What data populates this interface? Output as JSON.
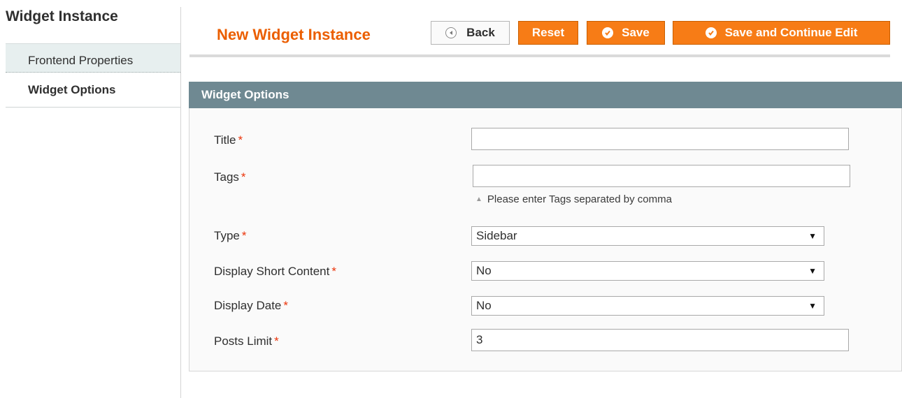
{
  "sidebar": {
    "title": "Widget Instance",
    "tabs": [
      {
        "label": "Frontend Properties"
      },
      {
        "label": "Widget Options"
      }
    ]
  },
  "header": {
    "title": "New Widget Instance",
    "buttons": {
      "back": "Back",
      "reset": "Reset",
      "save": "Save",
      "save_continue": "Save and Continue Edit"
    }
  },
  "section": {
    "title": "Widget Options"
  },
  "fields": {
    "title": {
      "label": "Title",
      "required": "*",
      "value": ""
    },
    "tags": {
      "label": "Tags",
      "required": "*",
      "value": "",
      "hint": "Please enter Tags separated by comma"
    },
    "type": {
      "label": "Type",
      "required": "*",
      "value": "Sidebar"
    },
    "display_short_content": {
      "label": "Display Short Content",
      "required": "*",
      "value": "No"
    },
    "display_date": {
      "label": "Display Date",
      "required": "*",
      "value": "No"
    },
    "posts_limit": {
      "label": "Posts Limit",
      "required": "*",
      "value": "3"
    }
  },
  "icons": {
    "back": "circle-left-arrow-icon",
    "save": "check-circle-icon",
    "hint": "triangle-up-icon",
    "select_caret": "caret-down-icon"
  },
  "colors": {
    "accent_orange": "#f77c16",
    "title_orange": "#eb5e00",
    "section_header": "#6f8992",
    "required_red": "#eb340a"
  }
}
